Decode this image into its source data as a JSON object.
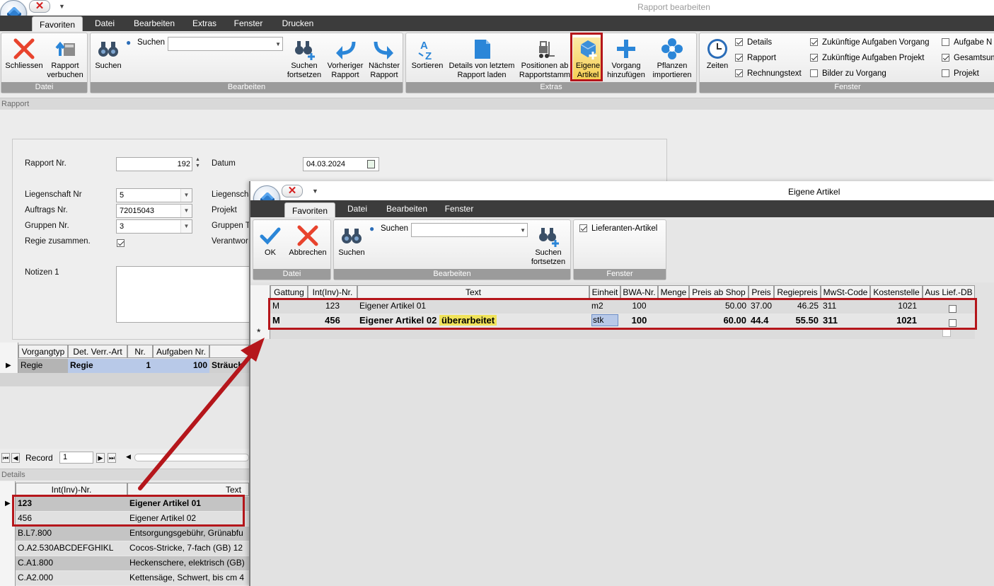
{
  "window": {
    "title": "Rapport bearbeiten"
  },
  "menu_tabs": [
    "Favoriten",
    "Datei",
    "Bearbeiten",
    "Extras",
    "Fenster",
    "Drucken"
  ],
  "ribbon": {
    "datei": {
      "label": "Datei",
      "close": "Schliessen",
      "post": [
        "Rapport",
        "verbuchen"
      ]
    },
    "bearbeiten": {
      "label": "Bearbeiten",
      "search": "Suchen",
      "search_field_label": "Suchen",
      "search_value": "",
      "search_next": [
        "Suchen",
        "fortsetzen"
      ],
      "prev": [
        "Vorheriger",
        "Rapport"
      ],
      "next": [
        "Nächster",
        "Rapport"
      ]
    },
    "extras": {
      "label": "Extras",
      "sort": "Sortieren",
      "load_details": [
        "Details von letztem",
        "Rapport laden"
      ],
      "positions": [
        "Positionen ab",
        "Rapportstamm"
      ],
      "own_article": [
        "Eigene",
        "Artikel"
      ],
      "add_task": [
        "Vorgang",
        "hinzufügen"
      ],
      "import_plants": [
        "Pflanzen",
        "importieren"
      ]
    },
    "fenster": {
      "label": "Fenster",
      "times": "Zeiten",
      "checks": [
        {
          "label": "Details",
          "checked": true
        },
        {
          "label": "Rapport",
          "checked": true
        },
        {
          "label": "Rechnungstext",
          "checked": true
        },
        {
          "label": "Zukünftige Aufgaben Vorgang",
          "checked": true
        },
        {
          "label": "Zukünftige Aufgaben Projekt",
          "checked": true
        },
        {
          "label": "Bilder zu Vorgang",
          "checked": false
        },
        {
          "label": "Aufgabe N",
          "checked": false
        },
        {
          "label": "Gesamtsum",
          "checked": true
        },
        {
          "label": "Projekt",
          "checked": false
        }
      ]
    }
  },
  "sections": {
    "rapport": "Rapport",
    "details": "Details"
  },
  "form": {
    "rapport_nr_label": "Rapport Nr.",
    "rapport_nr": "192",
    "datum_label": "Datum",
    "datum": "04.03.2024",
    "liegenschaft_nr_label": "Liegenschaft Nr",
    "liegenschaft_nr": "5",
    "liegenschaft_label": "Liegenscha",
    "auftrags_nr_label": "Auftrags Nr.",
    "auftrags_nr": "72015043",
    "projekt_label": "Projekt",
    "gruppen_nr_label": "Gruppen Nr.",
    "gruppen_nr": "3",
    "gruppen_t_label": "Gruppen T",
    "regie_label": "Regie zusammen.",
    "regie_checked": true,
    "verantwort_label": "Verantwor",
    "notizen_label": "Notizen 1",
    "notizen": ""
  },
  "vorgang_grid": {
    "headers": [
      "Vorgangtyp",
      "Det. Verr.-Art",
      "Nr.",
      "Aufgaben Nr.",
      ""
    ],
    "rows": [
      [
        "Regie",
        "Regie",
        "1",
        "100",
        "Sträuch"
      ]
    ],
    "record_label": "Record",
    "record_value": "1"
  },
  "details_grid": {
    "headers": [
      "Int(Inv)-Nr.",
      "Text"
    ],
    "rows": [
      [
        "123",
        "Eigener Artikel 01"
      ],
      [
        "456",
        "Eigener Artikel 02"
      ],
      [
        "B.L7.800",
        "Entsorgungsgebühr, Grünabfu"
      ],
      [
        "O.A2.530ABCDEFGHIKL",
        "Cocos-Stricke, 7-fach (GB) 12"
      ],
      [
        "C.A1.800",
        "Heckenschere, elektrisch (GB)"
      ],
      [
        "C.A2.000",
        "Kettensäge, Schwert, bis cm 4"
      ]
    ]
  },
  "dialog": {
    "title": "Eigene Artikel",
    "menu_tabs": [
      "Favoriten",
      "Datei",
      "Bearbeiten",
      "Fenster"
    ],
    "ribbon": {
      "datei_label": "Datei",
      "ok": "OK",
      "cancel": "Abbrechen",
      "bearbeiten_label": "Bearbeiten",
      "search": "Suchen",
      "search_field_label": "Suchen",
      "search_next": [
        "Suchen",
        "fortsetzen"
      ],
      "fenster_label": "Fenster",
      "supplier_articles": "Lieferanten-Artikel",
      "supplier_checked": true
    },
    "grid": {
      "headers": [
        "Gattung",
        "Int(Inv)-Nr.",
        "Text",
        "Einheit",
        "BWA-Nr.",
        "Menge",
        "Preis ab Shop",
        "Preis",
        "Regiepreis",
        "MwSt-Code",
        "Kostenstelle",
        "Aus Lief.-DB"
      ],
      "rows": [
        {
          "gattung": "M",
          "nr": "123",
          "text": "Eigener Artikel 01",
          "text_extra": "",
          "einheit": "m2",
          "bwa": "100",
          "menge": "",
          "preis_shop": "50.00",
          "preis": "37.00",
          "regie": "46.25",
          "mwst": "311",
          "kst": "1021",
          "lief": false
        },
        {
          "gattung": "M",
          "nr": "456",
          "text": "Eigener Artikel 02",
          "text_extra": "überarbeitet",
          "einheit": "stk",
          "bwa": "100",
          "menge": "",
          "preis_shop": "60.00",
          "preis": "44.4",
          "regie": "55.50",
          "mwst": "311",
          "kst": "1021",
          "lief": false
        }
      ],
      "new_row_marker": "*"
    }
  },
  "colors": {
    "highlight": "#b5161b",
    "menubar": "#3c3c3c",
    "group_label": "#9b9b9b",
    "selection": "#b8c9e8",
    "text_highlight": "#f0e35a"
  }
}
